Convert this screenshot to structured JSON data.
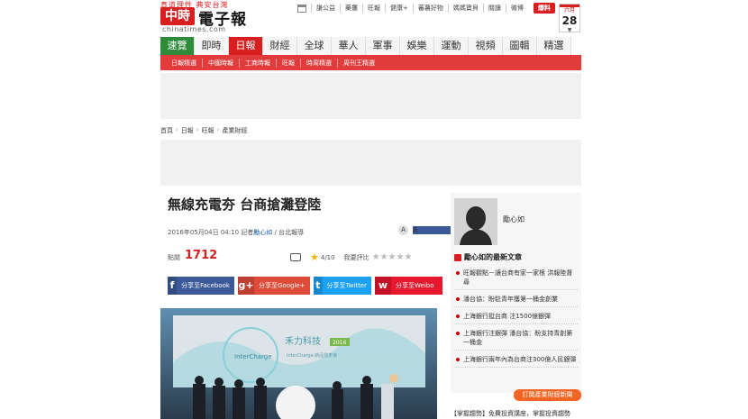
{
  "logo": {
    "slogan": "真道理性 典安台灣",
    "badge": "中時",
    "name": "電子報",
    "url": "chinatimes.com"
  },
  "topnav": {
    "links": [
      "謙公益",
      "藥攤",
      "旺報",
      "健康+",
      "蕃薯好物",
      "媽媽寶貝",
      "閱讀",
      "微博"
    ],
    "report": "爆料"
  },
  "date": {
    "month": "六月",
    "day": "28"
  },
  "mainnav": [
    "速覽",
    "即時",
    "日報",
    "財經",
    "全球",
    "華人",
    "軍事",
    "娛樂",
    "運動",
    "視頻",
    "圖輯",
    "精選"
  ],
  "subnav": [
    "日報精選",
    "中國時報",
    "工商時報",
    "旺報",
    "時周精選",
    "周刊王精選"
  ],
  "breadcrumb": [
    "首頁",
    "日報",
    "旺報",
    "產業財經"
  ],
  "article": {
    "title": "無線充電夯 台商搶灘登陸",
    "date": "2016年05月04日 04:10",
    "reporter_prefix": "記者",
    "reporter": "勵心如",
    "location": "/ 台北報導",
    "hits_label": "點閱",
    "hits": "1712",
    "rating": "4/10",
    "rate_label": "我要評比",
    "font_small": "A",
    "font_mid": "A",
    "font_large": "A"
  },
  "shares": [
    {
      "icon": "f",
      "label": "分享至Facebook",
      "color": "#3b5998"
    },
    {
      "icon": "g+",
      "label": "分享至Google+",
      "color": "#dd4b39"
    },
    {
      "icon": "t",
      "label": "分享至Twitter",
      "color": "#1da1f2"
    },
    {
      "icon": "w",
      "label": "分享至Weibo",
      "color": "#e6162d"
    }
  ],
  "photo": {
    "brand": "禾力科技",
    "year": "2016",
    "left_sign": "InterCharge",
    "subtitle": "InterCharge 新品發表會"
  },
  "sidebar": {
    "name": "勵心如",
    "heading": "勵心如的最新文章",
    "articles": [
      "旺報觀點－讓台商有家一家根 洪報陸督尋",
      "潘台協：盼駐青年獲第一桶金創業",
      "上海銀行挺台商 注1500億銀彈",
      "上海銀行注銀彈 潘台協：盼支持青創第一桶金",
      "上海銀行兩年內為台商注300億人民銀彈"
    ],
    "subscribe": "訂閱產業財經新聞"
  },
  "bottom_ad": "【掌握趨勢】免費投資講座，掌握投資趨勢"
}
